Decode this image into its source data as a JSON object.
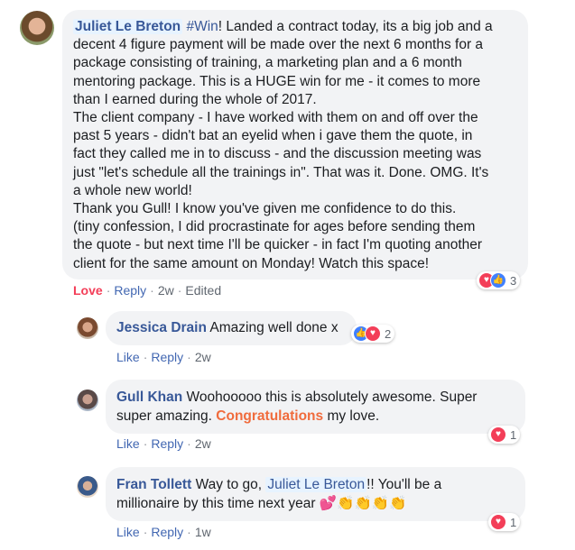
{
  "post": {
    "author": "Juliet Le Breton",
    "author_first": "Juliet",
    "author_last": "Le Breton",
    "hashtag": "#Win",
    "text_lines": [
      "! Landed a contract today, its a big job and a",
      "decent 4 figure payment will be made over the next 6 months for a",
      "package consisting of training, a marketing plan and a 6 month",
      "mentoring package. This is a HUGE win for me - it comes to more",
      "than I earned during the whole of 2017.",
      "The client company - I have worked with them on and off over the",
      "past 5 years - didn't bat an eyelid when i gave them the quote, in",
      "fact they called me in to discuss - and the discussion meeting was",
      "just \"let's schedule all the trainings in\". That was it. Done. OMG. It's",
      "a whole new world!",
      "Thank you Gull! I know you've given me confidence to do this.",
      "(tiny confession, I did procrastinate for ages before sending them",
      "the quote - but next time I'll be quicker - in fact I'm quoting another",
      "client for the same amount on Monday! Watch this space!"
    ],
    "reactions_count": "3",
    "actions": {
      "love": "Love",
      "reply": "Reply",
      "time": "2w",
      "edited": "Edited"
    }
  },
  "replies": [
    {
      "author": "Jessica Drain",
      "text": "Amazing well done x",
      "reactions_count": "2",
      "like": "Like",
      "reply": "Reply",
      "time": "2w"
    },
    {
      "author": "Gull Khan",
      "line1": "Woohooooo this is absolutely awesome. Super",
      "line2_pre": "super amazing.",
      "line2_highlight": "Congratulations",
      "line2_post": "my love.",
      "reactions_count": "1",
      "like": "Like",
      "reply": "Reply",
      "time": "2w"
    },
    {
      "author": "Fran Tollett",
      "pre": "Way to go,",
      "mention_first": "Juliet",
      "mention_last": "Le Breton",
      "post": "!! You'll be a",
      "line2": "millionaire by this time next year",
      "emoji": "💕👏👏👏👏",
      "reactions_count": "1",
      "like": "Like",
      "reply": "Reply",
      "time": "1w"
    }
  ],
  "colors": {
    "link": "#385898",
    "love": "#f33e58",
    "bubble": "#f2f3f5",
    "highlight": "#f06b3c"
  }
}
